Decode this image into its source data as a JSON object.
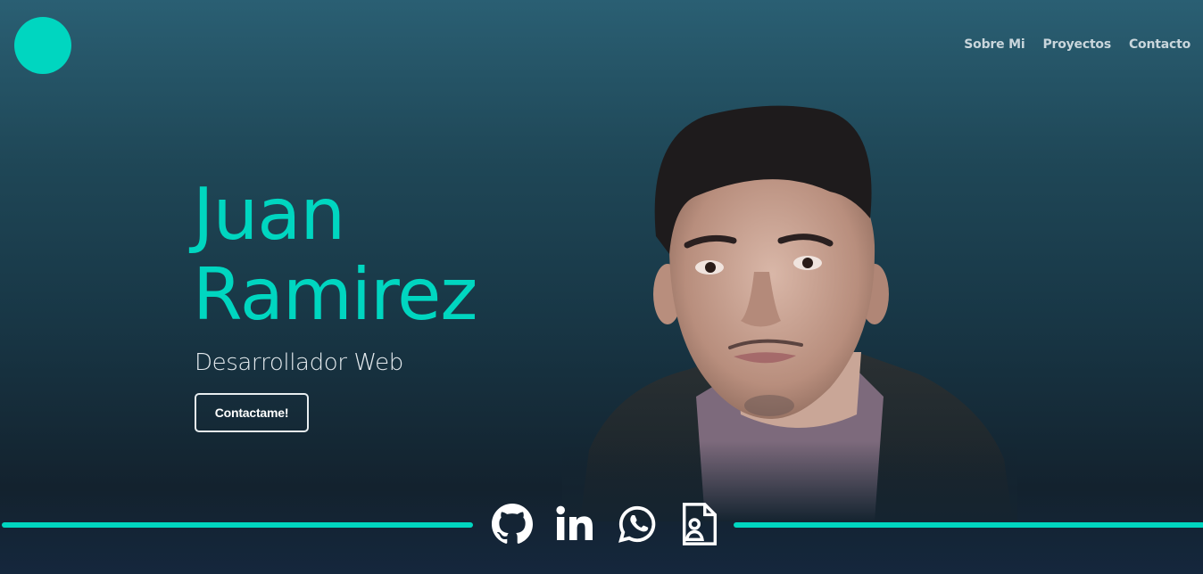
{
  "nav": {
    "items": [
      {
        "label": "Sobre Mi"
      },
      {
        "label": "Proyectos"
      },
      {
        "label": "Contacto"
      }
    ]
  },
  "hero": {
    "first_name": "Juan",
    "last_name": "Ramirez",
    "subtitle": "Desarrollador Web",
    "cta_label": "Contactame!"
  },
  "social": [
    {
      "icon": "github-icon"
    },
    {
      "icon": "linkedin-icon"
    },
    {
      "icon": "whatsapp-icon"
    },
    {
      "icon": "resume-icon"
    }
  ],
  "colors": {
    "accent": "#00d6c0",
    "background_top": "#2a5f73",
    "background_bottom": "#13222e"
  }
}
